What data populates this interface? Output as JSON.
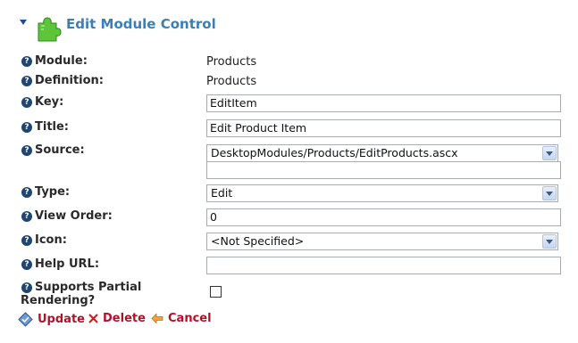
{
  "header": {
    "title": "Edit Module Control",
    "icon": "puzzle-piece-icon"
  },
  "fields": {
    "module": {
      "label": "Module:",
      "value": "Products"
    },
    "definition": {
      "label": "Definition:",
      "value": "Products"
    },
    "key": {
      "label": "Key:",
      "value": "EditItem"
    },
    "title": {
      "label": "Title:",
      "value": "Edit Product Item"
    },
    "source": {
      "label": "Source:",
      "selected": "DesktopModules/Products/EditProducts.ascx",
      "extra_value": ""
    },
    "type": {
      "label": "Type:",
      "selected": "Edit"
    },
    "view_order": {
      "label": "View Order:",
      "value": "0"
    },
    "icon": {
      "label": "Icon:",
      "selected": "<Not Specified>"
    },
    "help_url": {
      "label": "Help URL:",
      "value": ""
    },
    "partial_rendering": {
      "label_line1": "Supports Partial",
      "label_line2": "Rendering?",
      "checked": false
    }
  },
  "help_glyph": "?",
  "actions": {
    "update": "Update",
    "delete": "Delete",
    "cancel": "Cancel"
  },
  "colors": {
    "title": "#3b7fb3",
    "action": "#b0122a",
    "help_icon": "#20456f"
  }
}
